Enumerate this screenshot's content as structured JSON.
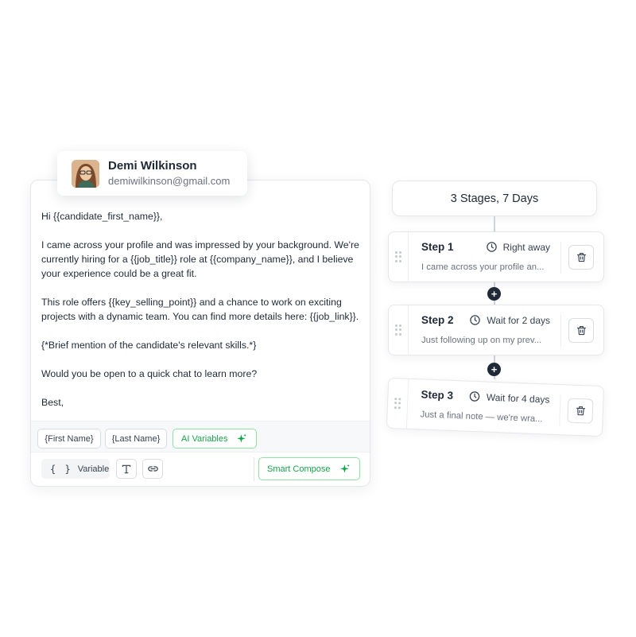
{
  "recipient": {
    "name": "Demi Wilkinson",
    "email": "demiwilkinson@gmail.com"
  },
  "email_body": {
    "greeting": "Hi {{candidate_first_name}},",
    "paragraph1": "I came across your profile and was impressed by your background. We're currently hiring for a {{job_title}} role at {{company_name}}, and I believe your experience could be a great fit.",
    "paragraph2": "This role offers {{key_selling_point}} and a chance to work on exciting projects with a dynamic team. You can find more details here: {{job_link}}.",
    "paragraph3": "{*Brief mention of the candidate's relevant skills.*}",
    "paragraph4": "Would you be open to a quick chat to learn more?",
    "signoff": "Best,"
  },
  "variables_bar": {
    "chips": [
      "{First Name}",
      "{Last Name}"
    ],
    "ai_label": "AI Variables"
  },
  "toolbar": {
    "variable_label": "Variable",
    "smart_compose_label": "Smart Compose"
  },
  "sequence": {
    "header": "3 Stages, 7 Days",
    "steps": [
      {
        "title": "Step 1",
        "wait": "Right away",
        "preview": "I came across your profile an..."
      },
      {
        "title": "Step 2",
        "wait": "Wait for 2 days",
        "preview": "Just following up on my prev..."
      },
      {
        "title": "Step 3",
        "wait": "Wait for 4 days",
        "preview": "Just a final note — we're wra..."
      }
    ]
  },
  "colors": {
    "accent_green": "#16a34a",
    "accent_green_border": "#8fe0a6",
    "dark": "#1f2937"
  }
}
